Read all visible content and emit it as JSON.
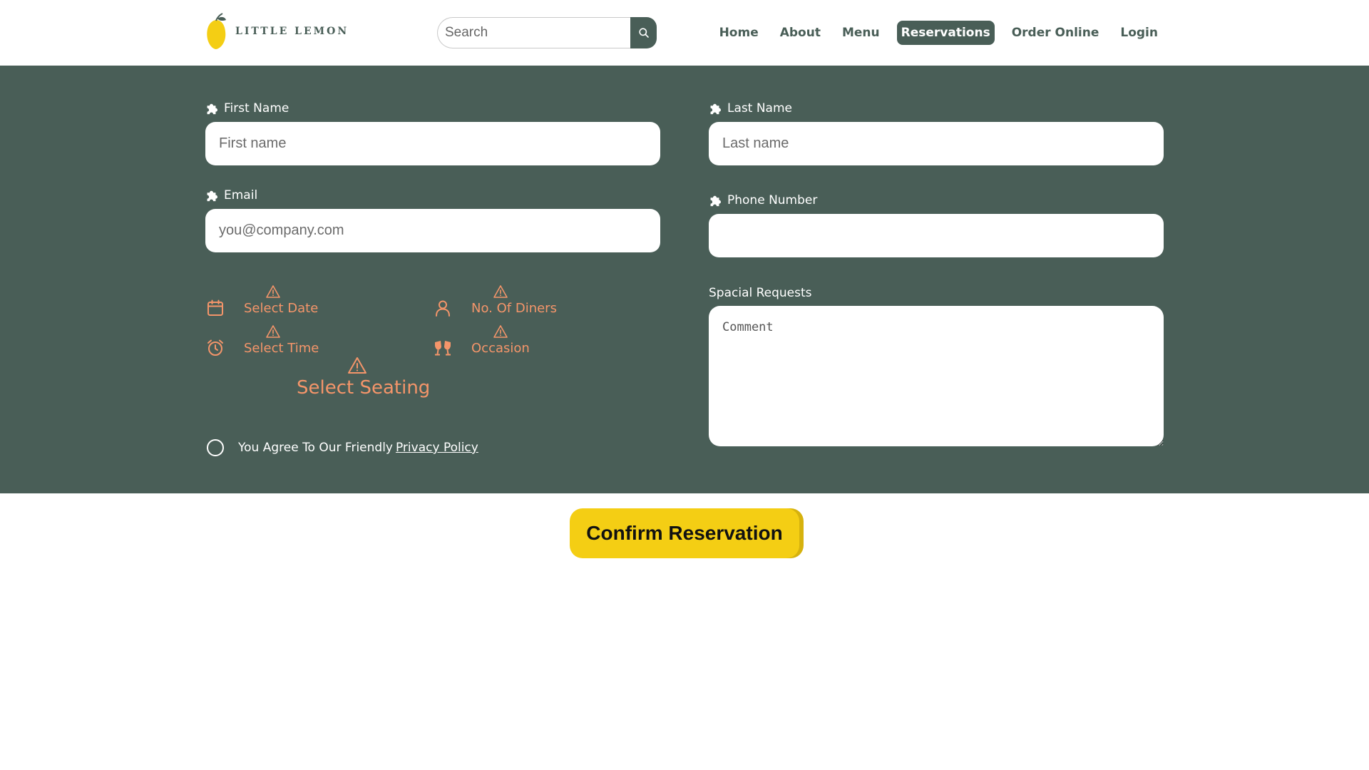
{
  "brand": {
    "name": "LITTLE LEMON"
  },
  "search": {
    "placeholder": "Search"
  },
  "nav": {
    "home": "Home",
    "about": "About",
    "menu": "Menu",
    "reservations": "Reservations",
    "order_online": "Order Online",
    "login": "Login"
  },
  "form": {
    "first_name": {
      "label": "First Name",
      "placeholder": "First name"
    },
    "last_name": {
      "label": "Last Name",
      "placeholder": "Last name"
    },
    "email": {
      "label": "Email",
      "placeholder": "you@company.com"
    },
    "phone": {
      "label": "Phone Number",
      "placeholder": ""
    },
    "select_date": "Select Date",
    "no_of_diners": "No. Of Diners",
    "select_time": "Select Time",
    "occasion": "Occasion",
    "select_seating": "Select Seating",
    "special_requests": {
      "label": "Spacial Requests",
      "placeholder": "Comment"
    },
    "agree_text": "You Agree To Our Friendly",
    "privacy_policy": "Privacy Policy",
    "confirm": "Confirm Reservation"
  },
  "colors": {
    "primary": "#495e57",
    "accent": "#f4ce14",
    "warning": "#f4956a"
  },
  "icons": [
    "lemon-logo-icon",
    "search-icon",
    "puzzle-icon",
    "calendar-icon",
    "user-icon",
    "alarm-clock-icon",
    "wine-glasses-icon",
    "warning-icon"
  ]
}
